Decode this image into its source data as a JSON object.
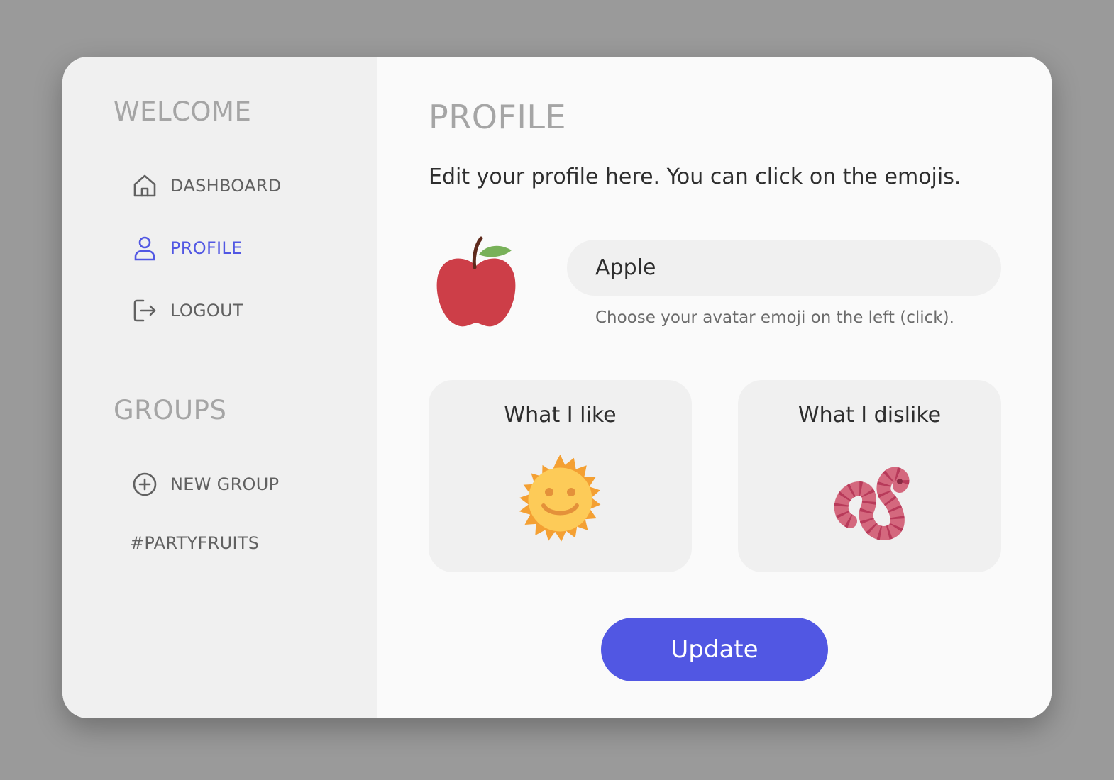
{
  "sidebar": {
    "welcome_title": "WELCOME",
    "nav": [
      {
        "label": "DASHBOARD",
        "icon": "home-icon",
        "active": false
      },
      {
        "label": "PROFILE",
        "icon": "user-icon",
        "active": true
      },
      {
        "label": "LOGOUT",
        "icon": "logout-icon",
        "active": false
      }
    ],
    "groups_title": "GROUPS",
    "new_group_label": "NEW GROUP",
    "new_group_icon": "plus-circle-icon",
    "groups": [
      "#PARTYFRUITS"
    ]
  },
  "main": {
    "title": "PROFILE",
    "intro": "Edit your profile here. You can click on the emojis.",
    "avatar_emoji": "apple-emoji",
    "name_value": "Apple",
    "hint": "Choose your avatar emoji on the left (click).",
    "like_title": "What I like",
    "like_emoji": "sun-with-face-emoji",
    "dislike_title": "What I dislike",
    "dislike_emoji": "worm-emoji",
    "update_label": "Update"
  },
  "colors": {
    "accent": "#5157e3",
    "background": "#9a9a9a",
    "sidebar": "#f0f0f0",
    "panel": "#fafafa"
  }
}
